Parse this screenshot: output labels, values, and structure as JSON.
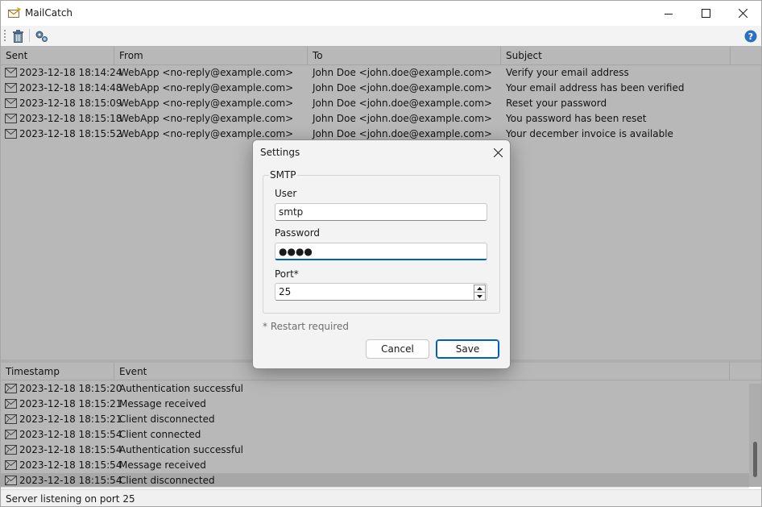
{
  "app": {
    "title": "MailCatch"
  },
  "toolbar": {
    "delete_icon": "trash-icon",
    "settings_icon": "gears-icon",
    "help_icon": "help-icon"
  },
  "messages": {
    "columns": [
      "Sent",
      "From",
      "To",
      "Subject"
    ],
    "rows": [
      {
        "sent": "2023-12-18 18:14:24",
        "from": "WebApp <no-reply@example.com>",
        "to": "John Doe <john.doe@example.com>",
        "subject": "Verify your email address"
      },
      {
        "sent": "2023-12-18 18:14:48",
        "from": "WebApp <no-reply@example.com>",
        "to": "John Doe <john.doe@example.com>",
        "subject": "Your email address has been verified"
      },
      {
        "sent": "2023-12-18 18:15:09",
        "from": "WebApp <no-reply@example.com>",
        "to": "John Doe <john.doe@example.com>",
        "subject": "Reset your password"
      },
      {
        "sent": "2023-12-18 18:15:18",
        "from": "WebApp <no-reply@example.com>",
        "to": "John Doe <john.doe@example.com>",
        "subject": "You password has been reset"
      },
      {
        "sent": "2023-12-18 18:15:52",
        "from": "WebApp <no-reply@example.com>",
        "to": "John Doe <john.doe@example.com>",
        "subject": "Your december invoice is available"
      }
    ]
  },
  "log": {
    "columns": [
      "Timestamp",
      "Event"
    ],
    "rows": [
      {
        "timestamp": "2023-12-18 18:15:20",
        "event": "Authentication successful"
      },
      {
        "timestamp": "2023-12-18 18:15:21",
        "event": "Message received"
      },
      {
        "timestamp": "2023-12-18 18:15:21",
        "event": "Client disconnected"
      },
      {
        "timestamp": "2023-12-18 18:15:54",
        "event": "Client connected"
      },
      {
        "timestamp": "2023-12-18 18:15:54",
        "event": "Authentication successful"
      },
      {
        "timestamp": "2023-12-18 18:15:54",
        "event": "Message received"
      },
      {
        "timestamp": "2023-12-18 18:15:54",
        "event": "Client disconnected"
      }
    ]
  },
  "status": {
    "text": "Server listening on port 25"
  },
  "settings_dialog": {
    "title": "Settings",
    "group": "SMTP",
    "user_label": "User",
    "user_value": "smtp",
    "password_label": "Password",
    "password_value": "●●●●",
    "port_label": "Port*",
    "port_value": "25",
    "note": "* Restart required",
    "cancel_label": "Cancel",
    "save_label": "Save"
  },
  "colors": {
    "accent": "#005fb8",
    "dim_overlay": "rgba(0,0,0,0.28)"
  }
}
